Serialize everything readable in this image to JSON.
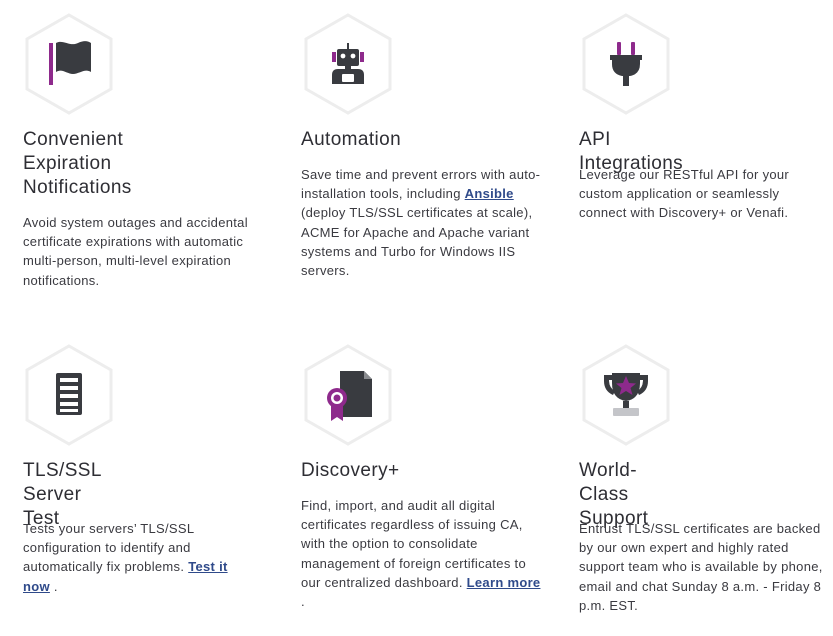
{
  "features": [
    {
      "icon": "flag-icon",
      "title_lines": [
        "Convenient",
        "Expiration",
        "Notifications"
      ],
      "desc": "Avoid system outages and accidental certificate expirations with automatic multi-person, multi-level expiration notifications."
    },
    {
      "icon": "robot-icon",
      "title_lines": [
        "Automation"
      ],
      "desc_before": "Save time and prevent errors with auto-installation tools, including ",
      "link": "Ansible",
      "desc_after": " (deploy TLS/SSL certificates at scale), ACME for Apache and Apache variant systems and Turbo for Windows IIS servers."
    },
    {
      "icon": "plug-icon",
      "title_lines": [
        "API Integrations"
      ],
      "desc": "Leverage our RESTful API for your custom application or seamlessly connect with Discovery+ or Venafi."
    },
    {
      "icon": "server-icon",
      "title_lines": [
        "TLS/SSL Server",
        "Test"
      ],
      "desc_before": "Tests your servers’ TLS/SSL configuration to identify and automatically fix problems. ",
      "link": "Test it now",
      "desc_after": " ."
    },
    {
      "icon": "certificate-icon",
      "title_lines": [
        "Discovery+"
      ],
      "desc_before": "Find, import, and audit all digital certificates regardless of issuing CA, with the option to consolidate management of foreign certificates to our centralized dashboard. ",
      "link": "Learn more",
      "desc_after": " ."
    },
    {
      "icon": "trophy-icon",
      "title_lines": [
        "World-Class",
        "Support"
      ],
      "desc": "Entrust TLS/SSL certificates are backed by our own expert and highly rated support team who is available by phone, email and chat Sunday 8 a.m. - Friday 8 p.m. EST."
    }
  ],
  "colors": {
    "accent": "#8e2a8c",
    "dark": "#393b40",
    "hex_border": "#ededed"
  }
}
